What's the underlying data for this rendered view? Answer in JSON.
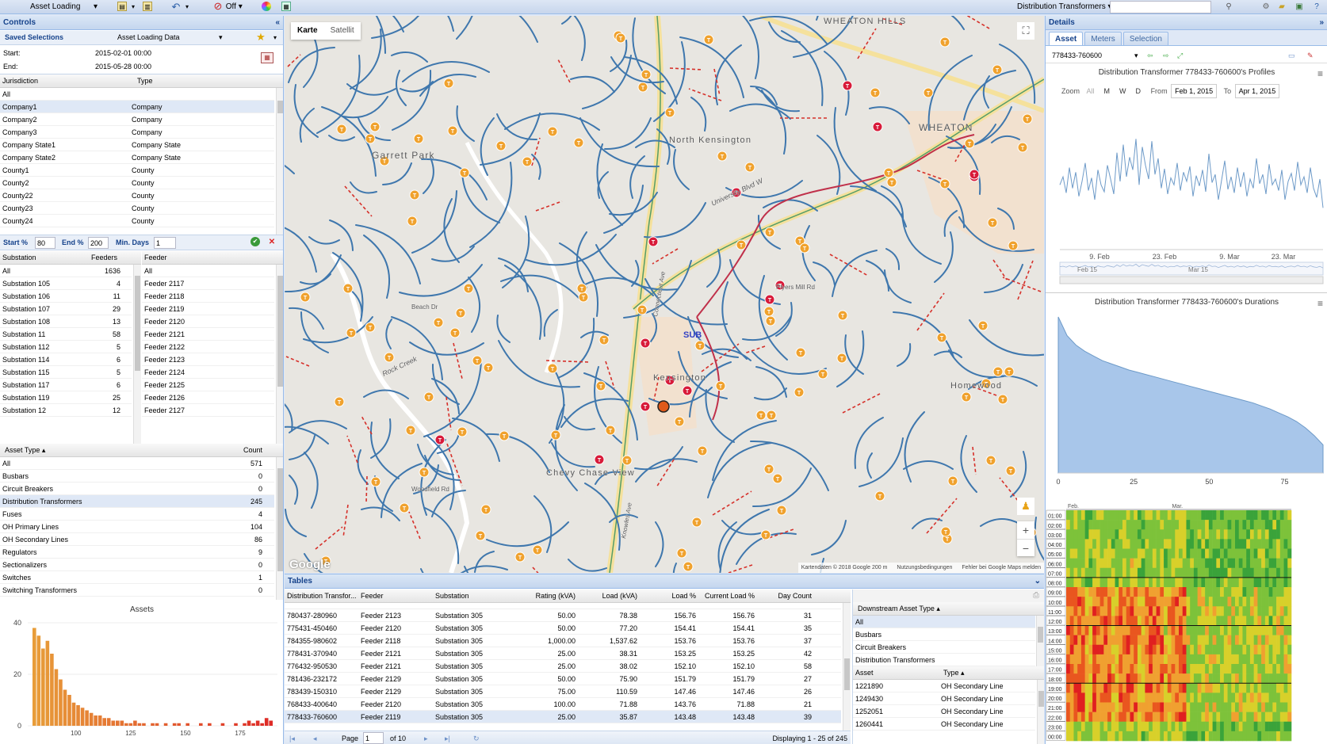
{
  "toolbar": {
    "view_select": "Asset Loading",
    "off_label": "Off",
    "right_select": "Distribution Transformers",
    "search_value": ""
  },
  "controls": {
    "title": "Controls",
    "saved_label": "Saved Selections",
    "saved_value": "Asset Loading Data",
    "start_label": "Start:",
    "start_value": "2015-02-01 00:00",
    "end_label": "End:",
    "end_value": "2015-05-28 00:00",
    "jurisdiction": {
      "headers": [
        "Jurisdiction",
        "Type"
      ],
      "rows": [
        [
          "All",
          ""
        ],
        [
          "Company1",
          "Company"
        ],
        [
          "Company2",
          "Company"
        ],
        [
          "Company3",
          "Company"
        ],
        [
          "Company State1",
          "Company State"
        ],
        [
          "Company State2",
          "Company State"
        ],
        [
          "County1",
          "County"
        ],
        [
          "County2",
          "County"
        ],
        [
          "County22",
          "County"
        ],
        [
          "County23",
          "County"
        ],
        [
          "County24",
          "County"
        ]
      ]
    },
    "filter": {
      "start_label": "Start %",
      "start_value": "80",
      "end_label": "End %",
      "end_value": "200",
      "days_label": "Min. Days",
      "days_value": "1"
    },
    "substation": {
      "headers": [
        "Substation",
        "Feeders"
      ],
      "rows": [
        [
          "All",
          "1636"
        ],
        [
          "Substation 105",
          "4"
        ],
        [
          "Substation 106",
          "11"
        ],
        [
          "Substation 107",
          "29"
        ],
        [
          "Substation 108",
          "13"
        ],
        [
          "Substation 11",
          "58"
        ],
        [
          "Substation 112",
          "5"
        ],
        [
          "Substation 114",
          "6"
        ],
        [
          "Substation 115",
          "5"
        ],
        [
          "Substation 117",
          "6"
        ],
        [
          "Substation 119",
          "25"
        ],
        [
          "Substation 12",
          "12"
        ]
      ]
    },
    "feeder": {
      "header": "Feeder",
      "rows": [
        "All",
        "Feeder 2117",
        "Feeder 2118",
        "Feeder 2119",
        "Feeder 2120",
        "Feeder 2121",
        "Feeder 2122",
        "Feeder 2123",
        "Feeder 2124",
        "Feeder 2125",
        "Feeder 2126",
        "Feeder 2127"
      ]
    },
    "asset_type": {
      "headers": [
        "Asset Type",
        "Count"
      ],
      "rows": [
        [
          "All",
          "571"
        ],
        [
          "Busbars",
          "0"
        ],
        [
          "Circuit Breakers",
          "0"
        ],
        [
          "Distribution Transformers",
          "245"
        ],
        [
          "Fuses",
          "4"
        ],
        [
          "OH Primary Lines",
          "104"
        ],
        [
          "OH Secondary Lines",
          "86"
        ],
        [
          "Regulators",
          "9"
        ],
        [
          "Sectionalizers",
          "0"
        ],
        [
          "Switches",
          "1"
        ],
        [
          "Switching Transformers",
          "0"
        ]
      ]
    },
    "assets_chart_title": "Assets"
  },
  "map": {
    "btn_map": "Karte",
    "btn_sat": "Satellit",
    "logo": "Google",
    "attribution": "Kartendaten © 2018 Google   200 m",
    "terms": "Nutzungsbedingungen",
    "report": "Fehler bei Google Maps melden",
    "labels": [
      "Garrett Park",
      "North Kensington",
      "Kensington",
      "Chevy Chase View",
      "Homewood",
      "WHEATON",
      "WHEATON HILLS",
      "Rock Creek",
      "University Blvd W",
      "Connecticut Ave",
      "Knowles Ave",
      "Plyers Mill Rd",
      "Beach Dr",
      "Woodfield Rd"
    ],
    "sub_label": "SUB"
  },
  "tables": {
    "title": "Tables",
    "headers": [
      "Distribution Transfor...",
      "Feeder",
      "Substation",
      "Rating (kVA)",
      "Load (kVA)",
      "Load %",
      "Current Load %",
      "Day Count"
    ],
    "rows": [
      [
        "780437-280960",
        "Feeder 2123",
        "Substation 305",
        "50.00",
        "78.38",
        "156.76",
        "156.76",
        "31"
      ],
      [
        "775431-450460",
        "Feeder 2120",
        "Substation 305",
        "50.00",
        "77.20",
        "154.41",
        "154.41",
        "35"
      ],
      [
        "784355-980602",
        "Feeder 2118",
        "Substation 305",
        "1,000.00",
        "1,537.62",
        "153.76",
        "153.76",
        "37"
      ],
      [
        "778431-370940",
        "Feeder 2121",
        "Substation 305",
        "25.00",
        "38.31",
        "153.25",
        "153.25",
        "42"
      ],
      [
        "776432-950530",
        "Feeder 2121",
        "Substation 305",
        "25.00",
        "38.02",
        "152.10",
        "152.10",
        "58"
      ],
      [
        "781436-232172",
        "Feeder 2129",
        "Substation 305",
        "50.00",
        "75.90",
        "151.79",
        "151.79",
        "27"
      ],
      [
        "783439-150310",
        "Feeder 2129",
        "Substation 305",
        "75.00",
        "110.59",
        "147.46",
        "147.46",
        "26"
      ],
      [
        "768433-400640",
        "Feeder 2120",
        "Substation 305",
        "100.00",
        "71.88",
        "143.76",
        "71.88",
        "21"
      ],
      [
        "778433-760600",
        "Feeder 2119",
        "Substation 305",
        "25.00",
        "35.87",
        "143.48",
        "143.48",
        "39"
      ]
    ],
    "pager": {
      "page_label": "Page",
      "page_value": "1",
      "of_label": "of 10",
      "display_text": "Displaying 1 - 25 of 245"
    },
    "downstream": {
      "header": "Downstream Asset Type",
      "rows": [
        "All",
        "Busbars",
        "Circuit Breakers",
        "Distribution Transformers"
      ]
    },
    "asset_list": {
      "headers": [
        "Asset",
        "Type"
      ],
      "rows": [
        [
          "1221890",
          "OH Secondary Line"
        ],
        [
          "1249430",
          "OH Secondary Line"
        ],
        [
          "1252051",
          "OH Secondary Line"
        ],
        [
          "1260441",
          "OH Secondary Line"
        ]
      ]
    }
  },
  "details": {
    "title": "Details",
    "tabs": [
      "Asset",
      "Meters",
      "Selection"
    ],
    "asset_select": "778433-760600",
    "profiles_title": "Distribution Transformer 778433-760600's Profiles",
    "zoom_label": "Zoom",
    "zoom_buttons": [
      "All",
      "M",
      "W",
      "D"
    ],
    "from_label": "From",
    "from_value": "Feb 1, 2015",
    "to_label": "To",
    "to_value": "Apr 1, 2015",
    "profile_xticks": [
      "9. Feb",
      "23. Feb",
      "9. Mar",
      "23. Mar"
    ],
    "navigator_labels": [
      "Feb 15",
      "Mar 15"
    ],
    "durations_title": "Distribution Transformer 778433-760600's Durations",
    "duration_xticks": [
      "0",
      "25",
      "50",
      "75"
    ],
    "heatmap_months": [
      "Feb.",
      "Mar."
    ],
    "heatmap_hours": [
      "01:00",
      "02:00",
      "03:00",
      "04:00",
      "05:00",
      "06:00",
      "07:00",
      "08:00",
      "09:00",
      "10:00",
      "11:00",
      "12:00",
      "13:00",
      "14:00",
      "15:00",
      "16:00",
      "17:00",
      "18:00",
      "19:00",
      "20:00",
      "21:00",
      "22:00",
      "23:00",
      "00:00"
    ]
  },
  "chart_data": [
    {
      "type": "bar",
      "title": "Assets",
      "ylim": [
        0,
        40
      ],
      "yticks": [
        "0",
        "20",
        "40"
      ],
      "xticks": [
        "100",
        "125",
        "150",
        "175"
      ],
      "x": [
        81,
        83,
        85,
        87,
        89,
        91,
        93,
        95,
        97,
        99,
        101,
        103,
        105,
        107,
        109,
        111,
        113,
        115,
        117,
        119,
        121,
        123,
        125,
        127,
        129,
        131,
        133,
        135,
        137,
        139,
        141,
        143,
        145,
        147,
        149,
        151,
        153,
        155,
        157,
        159,
        161,
        163,
        165,
        167,
        169,
        171,
        173,
        175,
        177,
        179,
        181,
        183,
        185,
        187,
        189
      ],
      "values": [
        38,
        35,
        30,
        33,
        28,
        22,
        18,
        14,
        12,
        9,
        8,
        7,
        6,
        5,
        4,
        4,
        3,
        3,
        2,
        2,
        2,
        1,
        1,
        2,
        1,
        1,
        0,
        1,
        1,
        0,
        1,
        0,
        1,
        1,
        0,
        1,
        0,
        0,
        1,
        0,
        1,
        0,
        0,
        1,
        0,
        0,
        1,
        0,
        1,
        2,
        1,
        2,
        1,
        3,
        2
      ]
    },
    {
      "type": "line",
      "title": "Distribution Transformer 778433-760600's Profiles",
      "xticks": [
        "9. Feb",
        "23. Feb",
        "9. Mar",
        "23. Mar"
      ],
      "values": [
        0.55,
        0.62,
        0.48,
        0.7,
        0.52,
        0.66,
        0.45,
        0.58,
        0.74,
        0.5,
        0.61,
        0.42,
        0.68,
        0.55,
        0.49,
        0.72,
        0.6,
        0.47,
        0.83,
        0.58,
        0.9,
        0.62,
        0.79,
        0.68,
        0.95,
        0.55,
        0.88,
        0.72,
        0.6,
        0.93,
        0.64,
        0.78,
        0.52,
        0.69,
        0.47,
        0.61,
        0.55,
        0.74,
        0.5,
        0.66,
        0.58,
        0.71,
        0.45,
        0.63,
        0.54,
        0.68,
        0.49,
        0.82,
        0.57,
        0.64,
        0.42,
        0.59,
        0.76,
        0.51,
        0.62,
        0.48,
        0.7,
        0.53,
        0.66,
        0.45,
        0.6,
        0.52,
        0.78,
        0.56,
        0.64,
        0.47,
        0.73,
        0.55,
        0.6,
        0.5,
        0.68,
        0.42,
        0.58,
        0.65,
        0.5,
        0.75,
        0.55,
        0.62,
        0.48,
        0.7,
        0.52,
        0.44,
        0.6,
        0.35
      ]
    },
    {
      "type": "area",
      "title": "Distribution Transformer 778433-760600's Durations",
      "xticks": [
        "0",
        "25",
        "50",
        "75"
      ],
      "xlim": [
        0,
        100
      ],
      "values": [
        1.0,
        0.88,
        0.82,
        0.78,
        0.75,
        0.72,
        0.7,
        0.68,
        0.66,
        0.645,
        0.63,
        0.615,
        0.6,
        0.585,
        0.57,
        0.555,
        0.54,
        0.525,
        0.51,
        0.495,
        0.48,
        0.465,
        0.45,
        0.43,
        0.41,
        0.385,
        0.36,
        0.33,
        0.29,
        0.24,
        0.18
      ]
    }
  ],
  "colors": {
    "accent": "#15428b",
    "panel_bg": "#dfe8f6",
    "bar_low": "#e8a03a",
    "bar_high": "#d6252b",
    "line_blue": "#6d9ac8",
    "area_blue": "#a8c6ea",
    "road_blue": "#3f77ad"
  }
}
